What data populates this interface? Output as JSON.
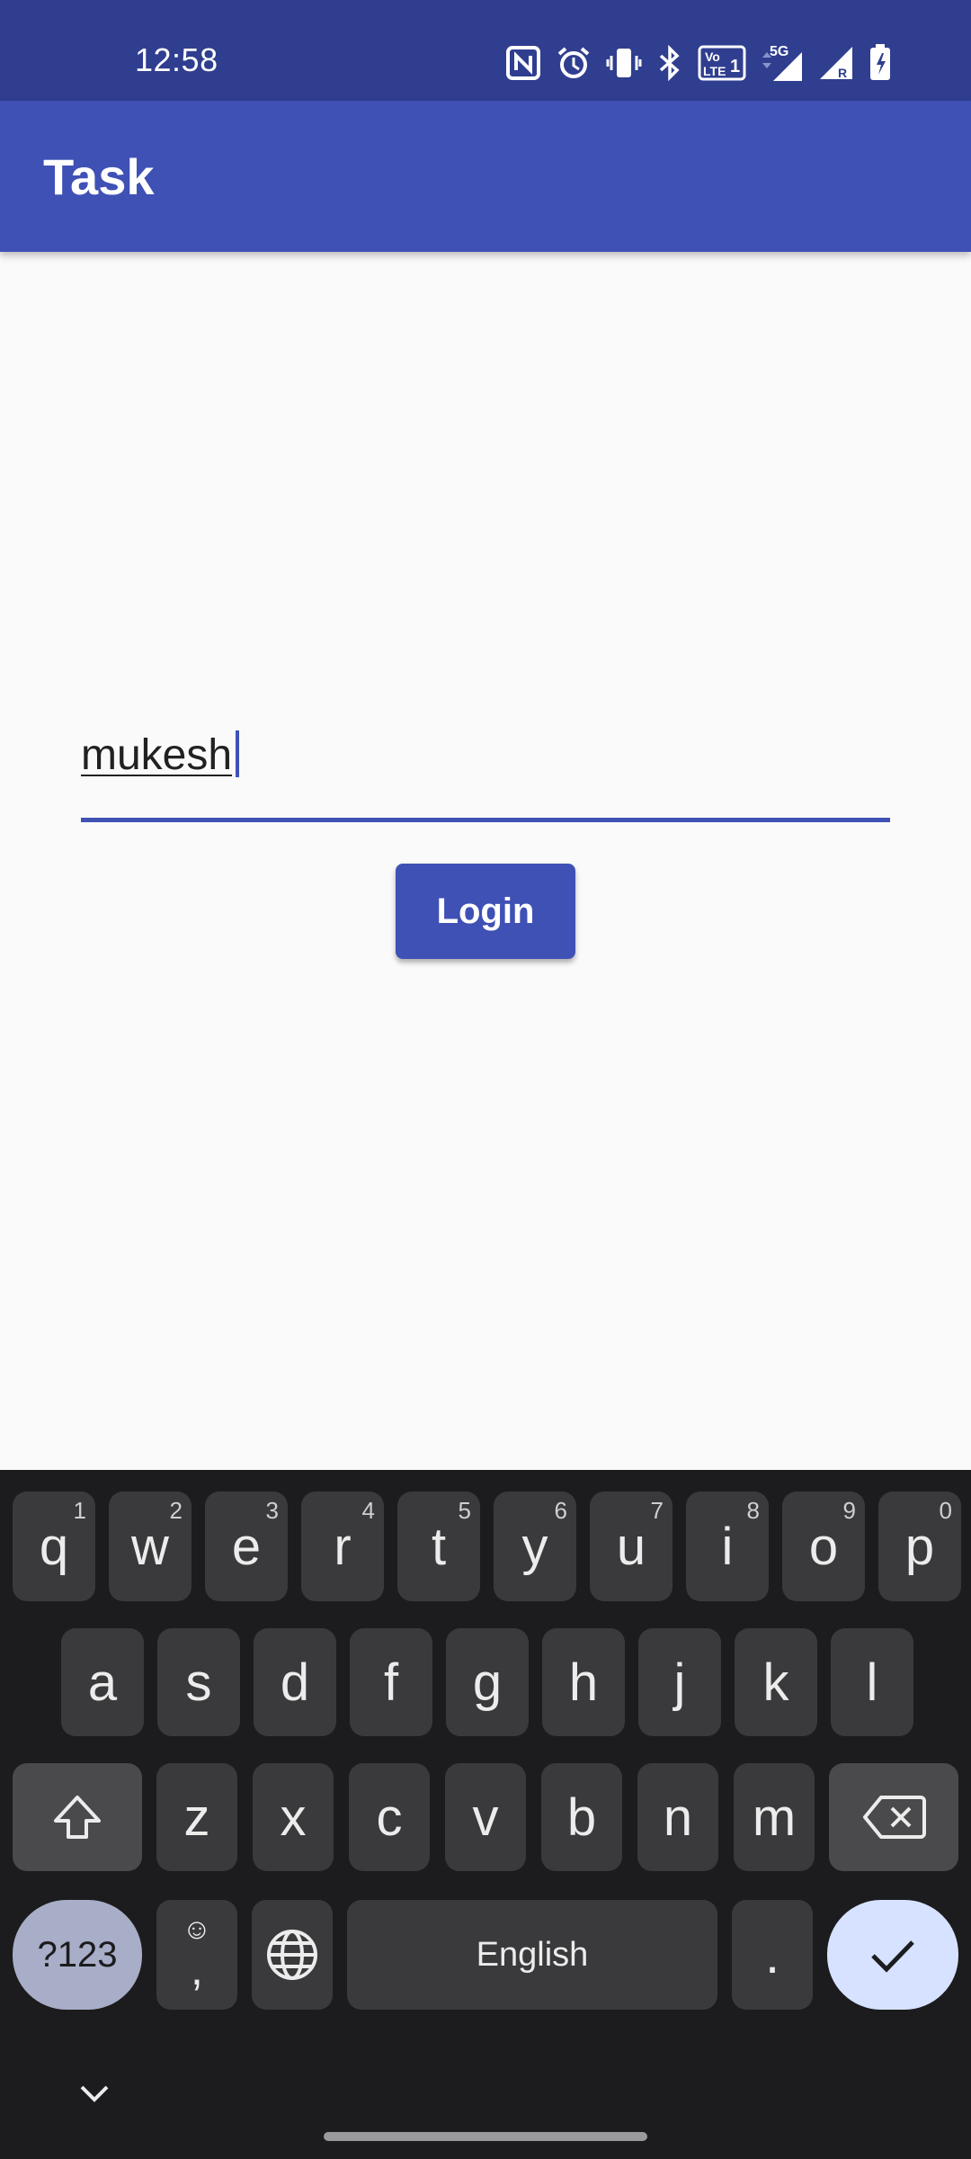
{
  "status_bar": {
    "time": "12:58",
    "icons": [
      "nfc-icon",
      "alarm-icon",
      "vibrate-icon",
      "bluetooth-icon",
      "volte-icon",
      "5g-icon",
      "signal-icon",
      "signal-roaming-icon",
      "battery-icon"
    ]
  },
  "app_bar": {
    "title": "Task"
  },
  "form": {
    "username_value": "mukesh",
    "login_label": "Login"
  },
  "keyboard": {
    "row1": [
      {
        "k": "q",
        "h": "1"
      },
      {
        "k": "w",
        "h": "2"
      },
      {
        "k": "e",
        "h": "3"
      },
      {
        "k": "r",
        "h": "4"
      },
      {
        "k": "t",
        "h": "5"
      },
      {
        "k": "y",
        "h": "6"
      },
      {
        "k": "u",
        "h": "7"
      },
      {
        "k": "i",
        "h": "8"
      },
      {
        "k": "o",
        "h": "9"
      },
      {
        "k": "p",
        "h": "0"
      }
    ],
    "row2": [
      "a",
      "s",
      "d",
      "f",
      "g",
      "h",
      "j",
      "k",
      "l"
    ],
    "row3": [
      "z",
      "x",
      "c",
      "v",
      "b",
      "n",
      "m"
    ],
    "symbols_label": "?123",
    "comma_label": ",",
    "space_label": "English",
    "period_label": "."
  },
  "colors": {
    "status_bar": "#2f3e8f",
    "primary": "#3f51b5",
    "keyboard_bg": "#1c1c1e",
    "key_bg": "#3a3a3c"
  }
}
